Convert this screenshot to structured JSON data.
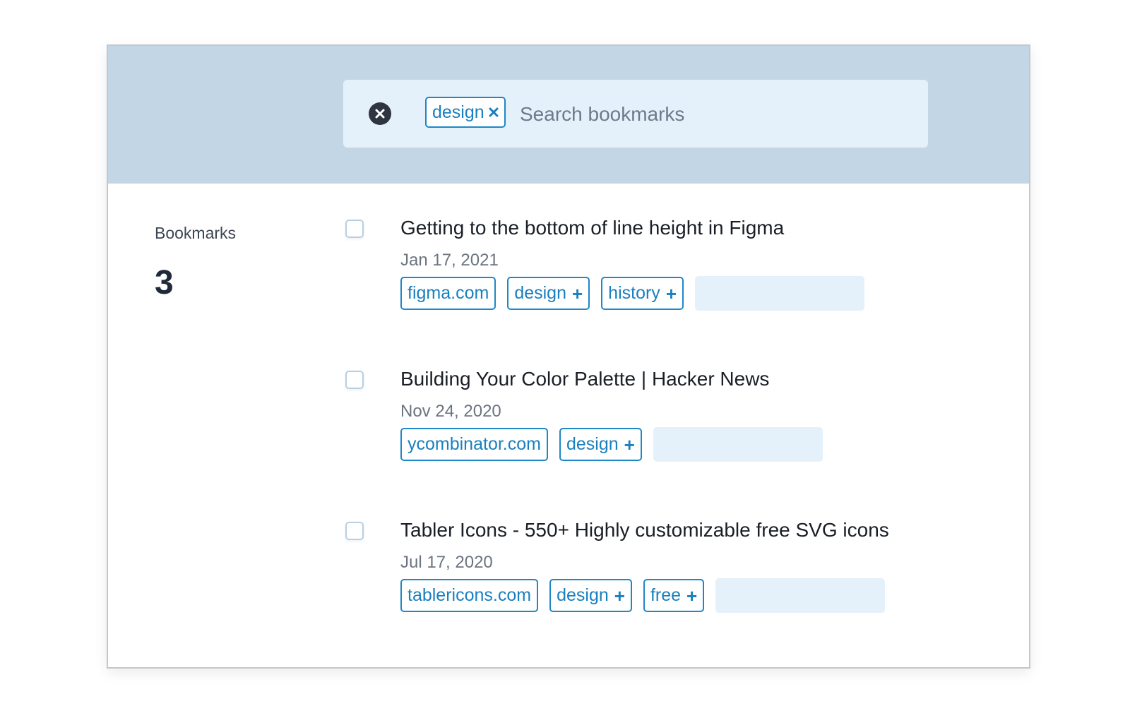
{
  "search": {
    "active_tag": "design",
    "placeholder": "Search bookmarks",
    "value": ""
  },
  "summary": {
    "label": "Bookmarks",
    "count": "3"
  },
  "bookmarks": [
    {
      "title": "Getting to the bottom of line height in Figma",
      "date": "Jan 17, 2021",
      "domain": "figma.com",
      "tags": [
        "design",
        "history"
      ]
    },
    {
      "title": "Building Your Color Palette | Hacker News",
      "date": "Nov 24, 2020",
      "domain": "ycombinator.com",
      "tags": [
        "design"
      ]
    },
    {
      "title": "Tabler Icons - 550+ Highly customizable free SVG icons",
      "date": "Jul 17, 2020",
      "domain": "tablericons.com",
      "tags": [
        "design",
        "free"
      ]
    }
  ],
  "icons": {
    "clear": "close-circle-icon",
    "remove_tag": "close-icon",
    "add_tag": "plus-icon"
  },
  "colors": {
    "header_bg": "#c2d6e6",
    "search_bg": "#e5f1fa",
    "tag_accent": "#1e87c8"
  }
}
